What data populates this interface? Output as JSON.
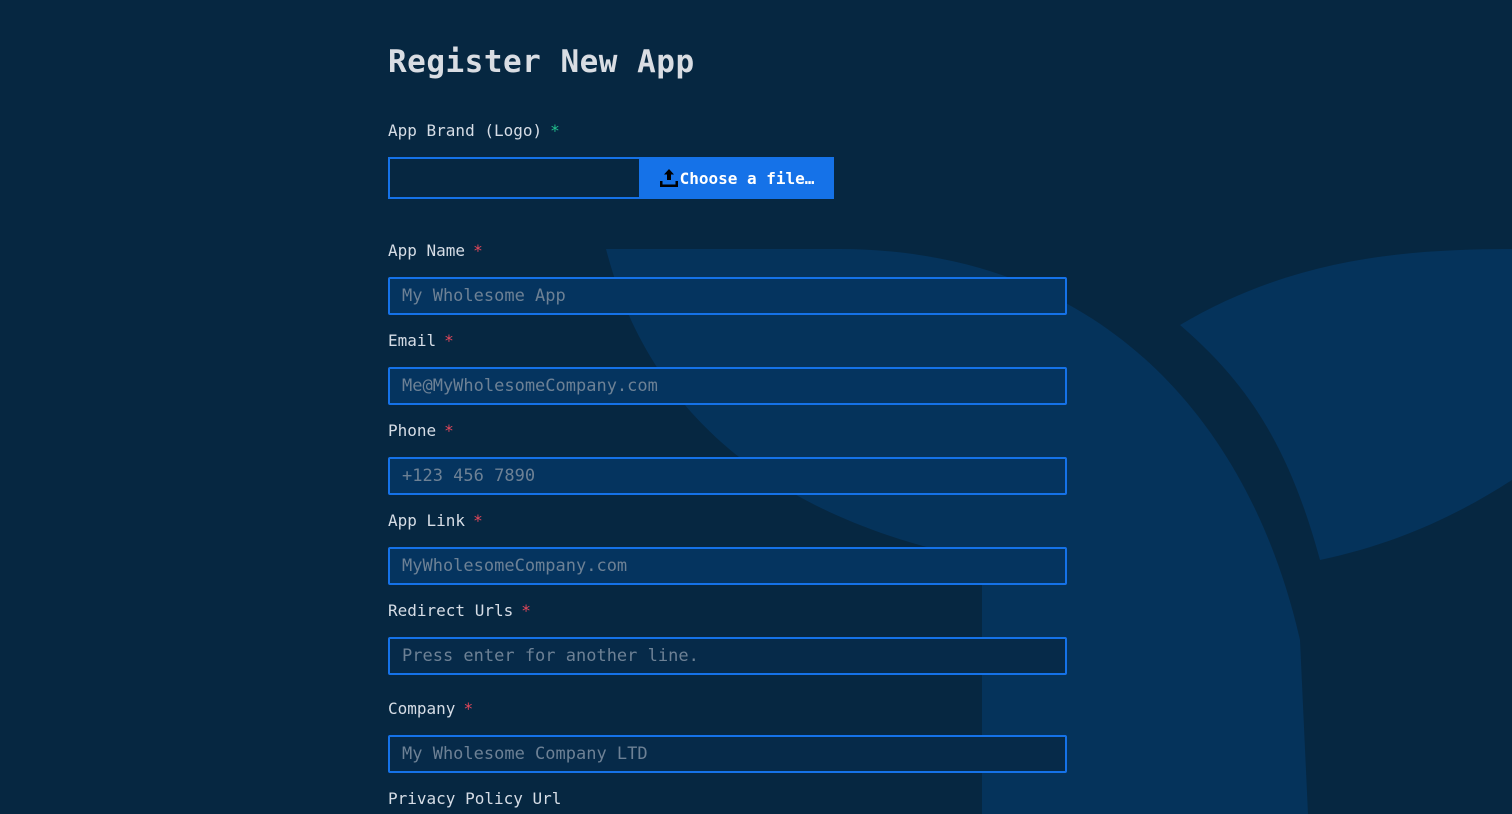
{
  "page": {
    "title": "Register New App"
  },
  "colors": {
    "background": "#062741",
    "accent": "#1572e8",
    "required_green": "#23c38e",
    "required_red": "#e5485b"
  },
  "form": {
    "logo": {
      "label": "App Brand (Logo)",
      "required_mark": "*",
      "button_label": "Choose a file…",
      "button_icon": "upload-icon"
    },
    "app_name": {
      "label": "App Name",
      "required_mark": "*",
      "placeholder": "My Wholesome App",
      "value": ""
    },
    "email": {
      "label": "Email",
      "required_mark": "*",
      "placeholder": "Me@MyWholesomeCompany.com",
      "value": ""
    },
    "phone": {
      "label": "Phone",
      "required_mark": "*",
      "placeholder": "+123 456 7890",
      "value": ""
    },
    "app_link": {
      "label": "App Link",
      "required_mark": "*",
      "placeholder": "MyWholesomeCompany.com",
      "value": ""
    },
    "redirect_urls": {
      "label": "Redirect Urls",
      "required_mark": "*",
      "placeholder": "Press enter for another line.",
      "value": ""
    },
    "company": {
      "label": "Company",
      "required_mark": "*",
      "placeholder": "My Wholesome Company LTD",
      "value": ""
    },
    "privacy_policy": {
      "label": "Privacy Policy Url"
    }
  }
}
